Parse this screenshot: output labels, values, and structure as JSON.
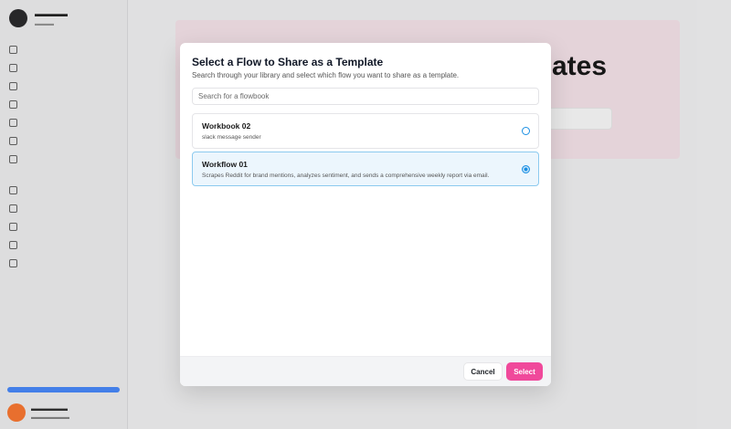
{
  "modal": {
    "title": "Select a Flow to Share as a Template",
    "subtitle": "Search through your library and select which flow you want to share as a template.",
    "search_placeholder": "Search for a flowbook",
    "flows": [
      {
        "title": "Workbook 02",
        "description": "slack message sender",
        "selected": false
      },
      {
        "title": "Workflow 01",
        "description": "Scrapes Reddit for brand mentions, analyzes sentiment, and sends a comprehensive weekly report via email.",
        "selected": true
      }
    ],
    "cancel_label": "Cancel",
    "select_label": "Select"
  },
  "background": {
    "hero_title": "ates"
  },
  "colors": {
    "accent": "#f0499b",
    "selected_bg": "#ecf6fd",
    "radio": "#1a8fe3",
    "hero_bg": "#fbe8ef"
  }
}
